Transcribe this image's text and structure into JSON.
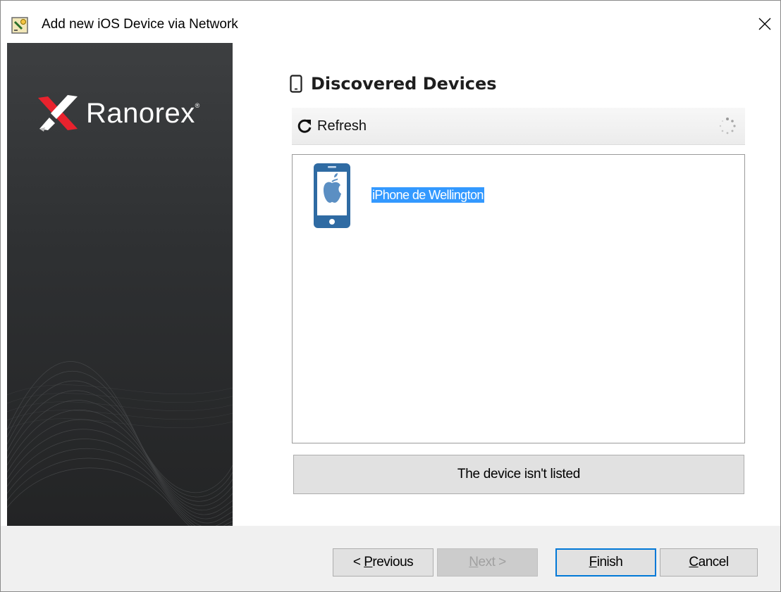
{
  "window": {
    "title": "Add new iOS Device via Network"
  },
  "brand": {
    "name": "Ranorex",
    "registered": "®"
  },
  "section": {
    "title": "Discovered Devices"
  },
  "toolbar": {
    "refresh_label": "Refresh"
  },
  "devices": [
    {
      "name": "iPhone de Wellington",
      "selected": true,
      "icon": "iphone-apple-icon"
    }
  ],
  "not_listed_label": "The device isn't listed",
  "footer": {
    "previous": {
      "prefix": "< ",
      "accel": "P",
      "rest": "revious",
      "enabled": true
    },
    "next": {
      "accel": "N",
      "rest": "ext >",
      "enabled": false
    },
    "finish": {
      "accel": "F",
      "rest": "inish",
      "enabled": true,
      "default": true
    },
    "cancel": {
      "accel": "C",
      "rest": "ancel",
      "enabled": true
    }
  },
  "colors": {
    "selection": "#3399ff",
    "device_icon": "#2f6ba3",
    "panel": "#2f3133"
  }
}
